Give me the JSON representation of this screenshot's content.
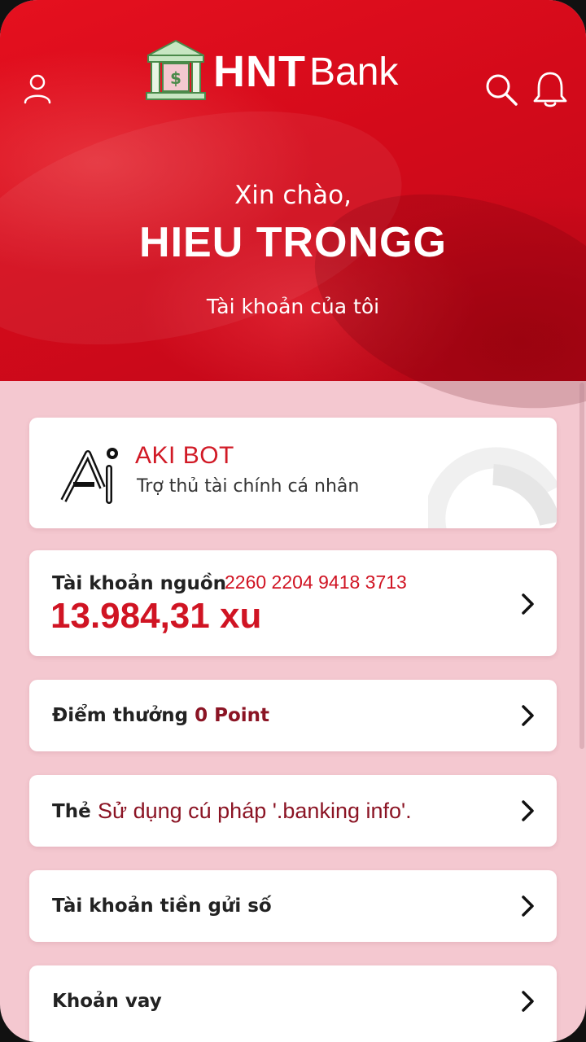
{
  "app": {
    "logo_hnt": "HNT",
    "logo_bank": "Bank",
    "greeting": "Xin chào,",
    "username": "HIEU TRONGG",
    "my_account": "Tài khoản của tôi"
  },
  "icons": {
    "profile": "user-icon",
    "search": "search-icon",
    "notifications": "bell-icon",
    "logo": "bank-building-icon",
    "chevron": "chevron-right-icon"
  },
  "aki_bot": {
    "title": "AKI BOT",
    "subtitle": "Trợ thủ tài chính cá nhân"
  },
  "source_account": {
    "label": "Tài khoản nguồn",
    "number": "2260 2204 9418 3713",
    "balance": "13.984,31 xu"
  },
  "rewards": {
    "label": "Điểm thưởng",
    "value": "0 Point"
  },
  "card_row": {
    "label": "Thẻ",
    "value": "Sử dụng cú pháp '.banking info'."
  },
  "savings": {
    "label": "Tài khoản tiền gửi số"
  },
  "loans": {
    "label": "Khoản vay"
  },
  "colors": {
    "brand_red": "#d40a1a",
    "accent_red": "#d01423",
    "dark_red": "#8b1424",
    "background_pink": "#f4c8d0"
  }
}
